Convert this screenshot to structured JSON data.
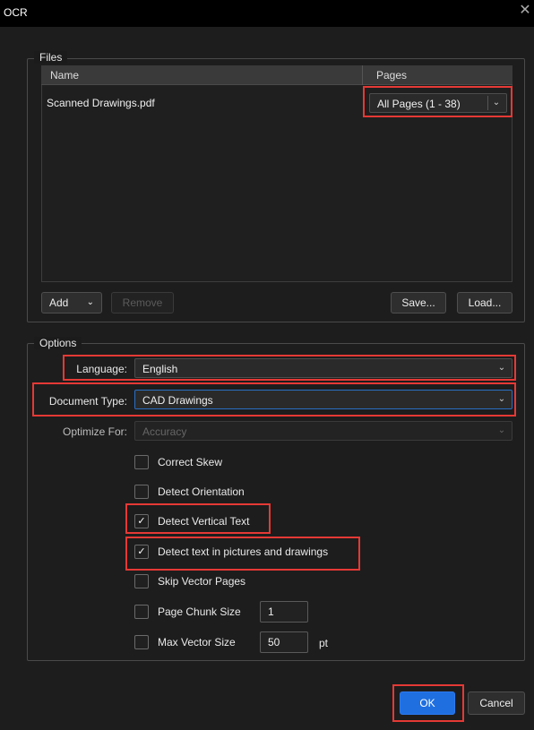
{
  "window": {
    "title": "OCR",
    "close_glyph": "✕"
  },
  "files": {
    "group_label": "Files",
    "columns": {
      "name": "Name",
      "pages": "Pages"
    },
    "rows": [
      {
        "name": "Scanned Drawings.pdf",
        "pages": "All Pages (1 - 38)"
      }
    ],
    "buttons": {
      "add": "Add",
      "remove": "Remove",
      "save": "Save...",
      "load": "Load..."
    }
  },
  "options": {
    "group_label": "Options",
    "language": {
      "label": "Language:",
      "value": "English"
    },
    "document_type": {
      "label": "Document Type:",
      "value": "CAD Drawings"
    },
    "optimize_for": {
      "label": "Optimize For:",
      "value": "Accuracy"
    },
    "checkboxes": [
      {
        "label": "Correct Skew",
        "checked": false
      },
      {
        "label": "Detect Orientation",
        "checked": false
      },
      {
        "label": "Detect Vertical Text",
        "checked": true
      },
      {
        "label": "Detect text in pictures and drawings",
        "checked": true
      },
      {
        "label": "Skip Vector Pages",
        "checked": false
      },
      {
        "label": "Page Chunk Size",
        "checked": false,
        "value": "1"
      },
      {
        "label": "Max Vector Size",
        "checked": false,
        "value": "50",
        "unit": "pt"
      }
    ]
  },
  "footer": {
    "ok": "OK",
    "cancel": "Cancel"
  },
  "icons": {
    "chevron": "chevron-down-icon",
    "check": "checkmark-icon",
    "close": "close-icon"
  },
  "colors": {
    "highlight": "#e53935",
    "accent": "#1f6fe0",
    "background": "#1b1b1b"
  }
}
